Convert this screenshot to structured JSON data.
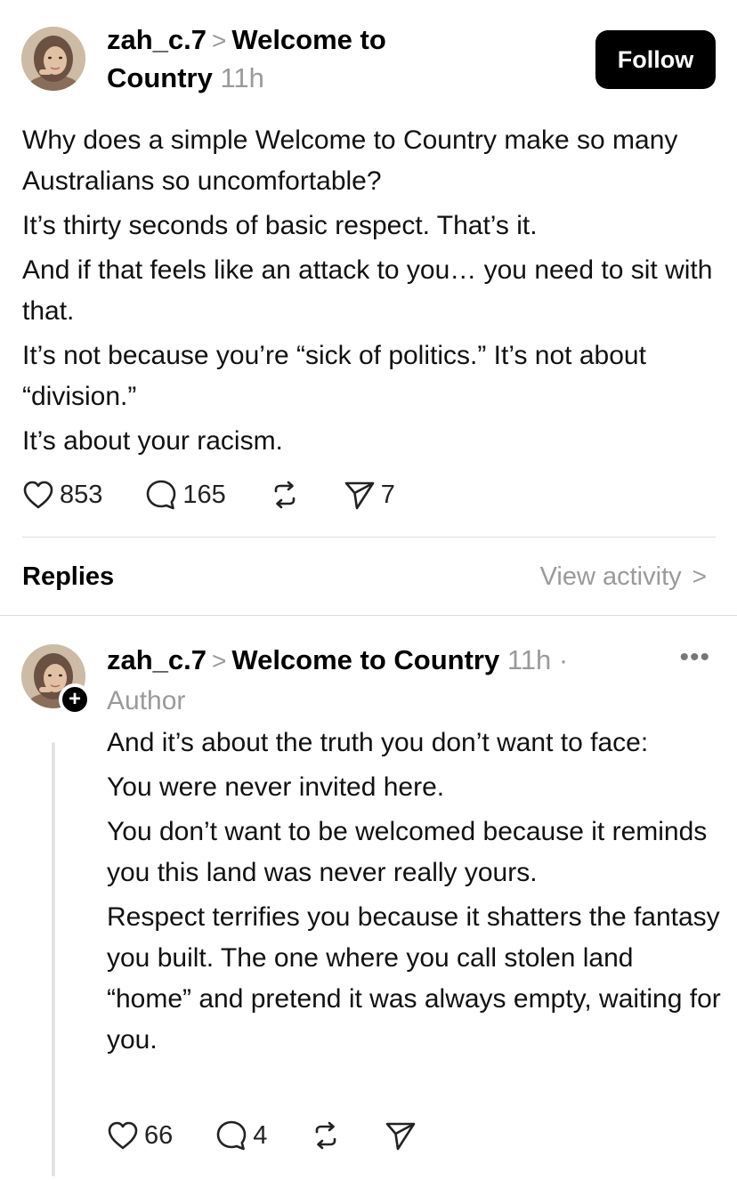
{
  "post": {
    "username": "zah_c.7",
    "chevron": ">",
    "topic_line1": "Welcome to",
    "topic_line2": "Country",
    "time": "11h",
    "follow_label": "Follow",
    "paragraphs": [
      "Why does a simple Welcome to Country make so many Australians so uncomfortable?",
      "It’s thirty seconds of basic respect. That’s it.",
      "And if that feels like an attack to you… you need to sit with that.",
      "It’s not because you’re “sick of politics.” It’s not about “division.”",
      "It’s about your racism."
    ],
    "likes": "853",
    "comments": "165",
    "shares": "7"
  },
  "replies_section": {
    "label": "Replies",
    "view_activity": "View activity",
    "chevron": ">"
  },
  "reply": {
    "username": "zah_c.7",
    "chevron": ">",
    "topic": "Welcome to Country",
    "time": "11h",
    "dot": "·",
    "author_label": "Author",
    "more": "•••",
    "plus": "+",
    "paragraphs": [
      "And it’s about the truth you don’t want to face:",
      "You were never invited here.",
      "You don’t want to be welcomed because it reminds you this land was never really yours.",
      "Respect terrifies you because it shatters the fantasy you built. The one where you call stolen land “home” and pretend it was always empty, waiting for you."
    ],
    "likes": "66",
    "comments": "4"
  },
  "icons": {
    "like": "heart-icon",
    "comment": "comment-bubble-icon",
    "repost": "repost-icon",
    "share": "send-icon",
    "more": "more-dots-icon"
  },
  "colors": {
    "text": "#000000",
    "muted": "#9a9a9a",
    "button_bg": "#000000",
    "button_text": "#ffffff",
    "divider": "#dcdcdc"
  }
}
